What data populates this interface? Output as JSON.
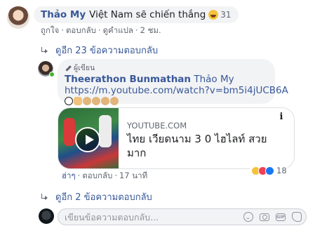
{
  "comment": {
    "author": "Thảo My",
    "text": "Việt Nam sẽ chiến thắng",
    "reaction_count": "31",
    "actions": [
      "ถูกใจ",
      "ตอบกลับ",
      "ดูคำแปล"
    ],
    "time": "2 ชม."
  },
  "more_replies_top": "ดูอีก 23 ข้อความตอบกลับ",
  "reply": {
    "writer_label": "ผู้เขียน",
    "author": "Theerathon Bunmathan",
    "mention": "Thảo My",
    "url": "https://m.youtube.com/watch?v=bm5i4jUCB6A",
    "emojis": [
      "ball-icon",
      "arm-icon",
      "monkey-icon",
      "monkey-icon",
      "monkey-icon",
      "monkey-icon"
    ],
    "link_card": {
      "domain": "YOUTUBE.COM",
      "title": "ไทย เวียดนาม 3 0 ไฮไลท์ สวยมาก",
      "info_icon": "i"
    },
    "actions": [
      "ฮ่าๆ",
      "ตอบกลับ"
    ],
    "time": "17 นาที",
    "reactions": {
      "icons": [
        "haha-icon",
        "love-icon",
        "like-icon"
      ],
      "count": "18"
    }
  },
  "more_replies_bottom": "ดูอีก 2 ข้อความตอบกลับ",
  "composer": {
    "placeholder": "เขียนข้อความตอบกลับ..."
  },
  "colors": {
    "link": "#385898",
    "bubble": "#f2f3f5",
    "meta": "#606770"
  }
}
